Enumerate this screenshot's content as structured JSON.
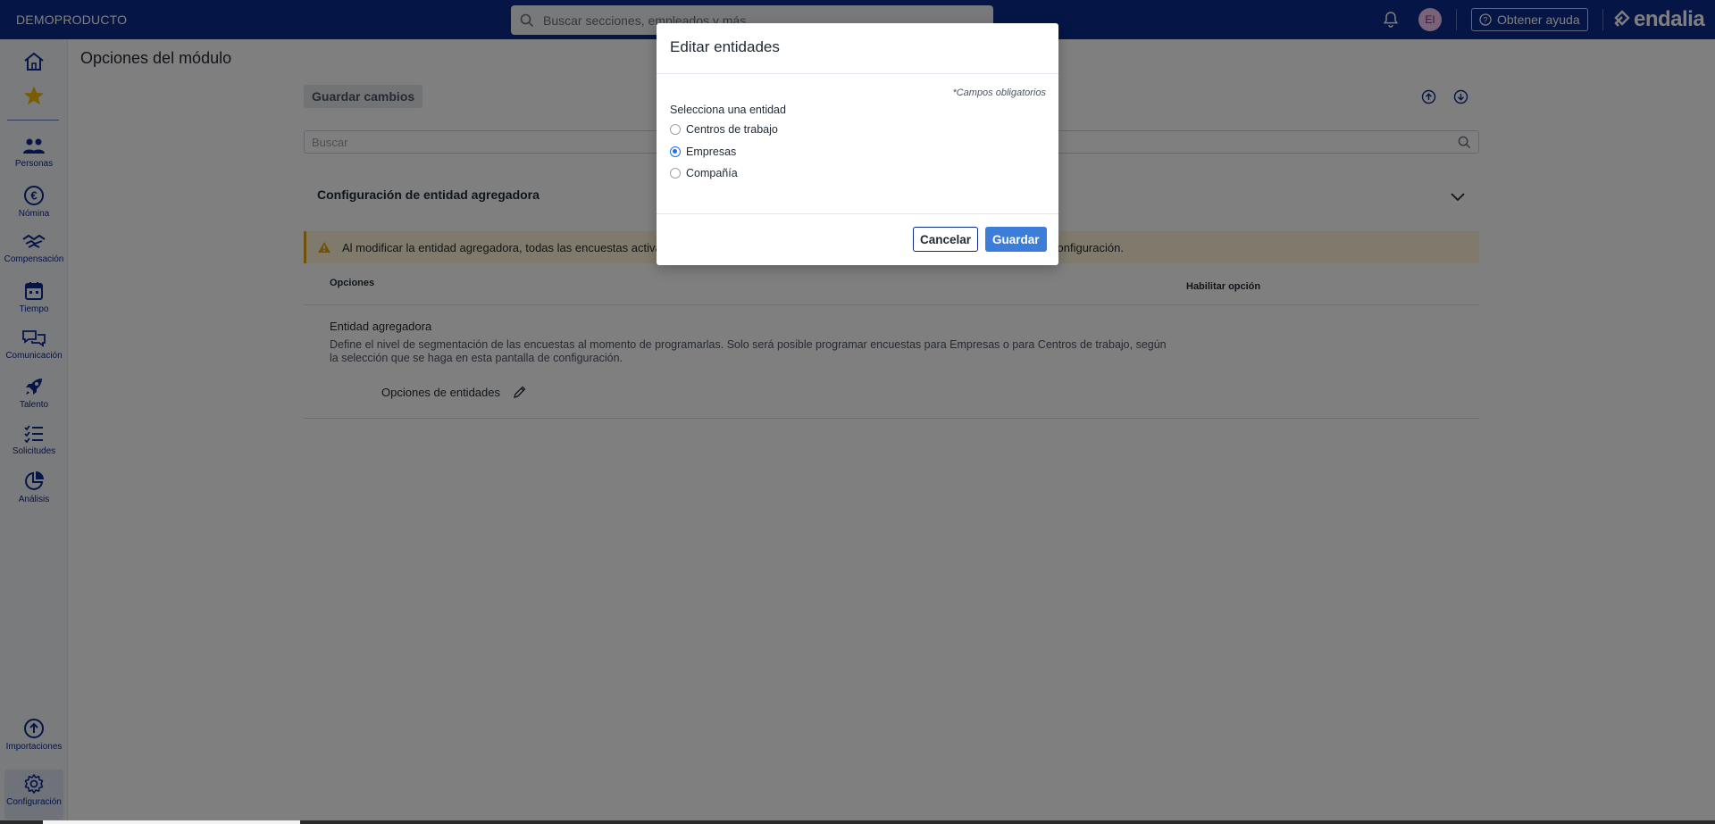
{
  "header": {
    "brand": "DEMOPRODUCTO",
    "search_placeholder": "Buscar secciones, empleados y más",
    "avatar_initials": "EI",
    "help_label": "Obtener ayuda",
    "logo_text": "endalia"
  },
  "sidebar": {
    "items": [
      {
        "label": "",
        "icon": "home-icon"
      },
      {
        "label": "",
        "icon": "star-icon"
      },
      {
        "label": "Personas",
        "icon": "people-icon"
      },
      {
        "label": "Nómina",
        "icon": "euro-icon"
      },
      {
        "label": "Compensación",
        "icon": "handshake-icon"
      },
      {
        "label": "Tiempo",
        "icon": "calendar-icon"
      },
      {
        "label": "Comunicación",
        "icon": "chat-icon"
      },
      {
        "label": "Talento",
        "icon": "rocket-icon"
      },
      {
        "label": "Solicitudes",
        "icon": "list-icon"
      },
      {
        "label": "Análisis",
        "icon": "pie-chart-icon"
      },
      {
        "label": "Importaciones",
        "icon": "upload-icon"
      },
      {
        "label": "Configuración",
        "icon": "gear-icon"
      }
    ]
  },
  "main": {
    "title": "Opciones del módulo",
    "save_changes": "Guardar cambios",
    "search_placeholder": "Buscar",
    "section_title": "Configuración de entidad agregadora",
    "warning": "Al modificar la entidad agregadora, todas las encuestas activas ... configuración.",
    "warning_start": "Al modificar la entidad agregadora, todas las encuestas activas",
    "warning_end": "configuración.",
    "table": {
      "col_options": "Opciones",
      "col_enable": "Habilitar opción",
      "row_title": "Entidad agregadora",
      "row_desc": "Define el nivel de segmentación de las encuestas al momento de programarlas. Solo será posible programar encuestas para Empresas o para Centros de trabajo, según la selección que se haga en esta pantalla de configuración.",
      "row_option": "Opciones de entidades"
    }
  },
  "modal": {
    "title": "Editar entidades",
    "required_note": "*Campos obligatorios",
    "select_label": "Selecciona una entidad",
    "options": [
      {
        "label": "Centros de trabajo",
        "checked": false
      },
      {
        "label": "Empresas",
        "checked": true
      },
      {
        "label": "Compañía",
        "checked": false
      }
    ],
    "cancel": "Cancelar",
    "save": "Guardar"
  },
  "colors": {
    "brand_navy": "#0b2a8c",
    "primary_button": "#3b7dd8",
    "warning_bg": "#fff4d6",
    "warning_accent": "#e8a317"
  }
}
